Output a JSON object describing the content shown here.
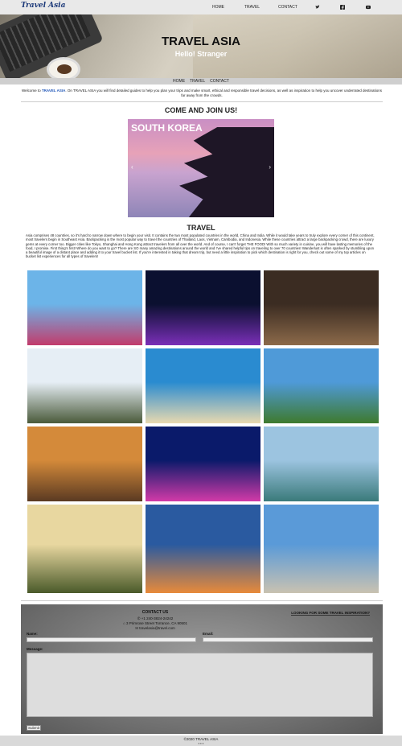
{
  "nav": {
    "logo": "Travel Asia",
    "links": [
      "HOME",
      "TRAVEL",
      "CONTACT"
    ],
    "social": [
      "twitter-icon",
      "facebook-icon",
      "youtube-icon"
    ]
  },
  "hero": {
    "title": "TRAVEL ASIA",
    "subtitle": "Hello! Stranger"
  },
  "subnav": {
    "links": [
      "HOME",
      "TRAVEL",
      "CONTACT"
    ]
  },
  "welcome": {
    "prefix": "Welcome to ",
    "brand": "TRAVEL ASIA",
    "text": ". On TRAVEL ASIA you will find detailed guides to help you plan your trips and make smart, ethical and responsible travel decisions, as well as inspiration to help you uncover underrated destinations far away from the crowds."
  },
  "join": {
    "heading": "COME AND JOIN US!",
    "slide_caption": "SOUTH KOREA",
    "prev": "‹",
    "next": "›"
  },
  "travel": {
    "heading": "TRAVEL",
    "paragraph": "Asia comprises 48 countries, so it's hard to narrow down where to begin your visit. It contains the two most populated countries in the world, China and India. While it would take years to truly explore every corner of this continent, most travelers begin in Southeast Asia. Backpacking is the most popular way to travel the countries of Thailand, Laos, Vietnam, Cambodia, and Indonesia. While these countries attract a large backpacking crowd, there are luxury gems at every corner too. Bigger cities like Tokyo, Shanghai and Hong Kong attract travelers from all over the world. And of course, I can't forget THE FOOD! With so much variety in cuisine, you will have lasting memories of the food, I promise. First thing's first! Where do you want to go? There are SO many amazing destinations around the world and I've shared helpful tips on traveling to over 70 countries! Wanderlust is often sparked by stumbling upon a beautiful image of a distant place and adding it to your travel bucket list. If you're interested in taking that dream trip, but need a little inspiration to pick which destination is right for you, check out some of my top articles on bucket list experiences for all types of travelers!"
  },
  "gallery": [
    {
      "name": "seoul-tower-photo",
      "colors": [
        "#6cb4e8",
        "#c23b6b"
      ]
    },
    {
      "name": "shanghai-night-photo",
      "colors": [
        "#0b1030",
        "#7a2fb8"
      ]
    },
    {
      "name": "kyoto-street-photo",
      "colors": [
        "#3b2c22",
        "#8c6a4a"
      ]
    },
    {
      "name": "temple-gate-photo",
      "colors": [
        "#e6eef5",
        "#4a5a3a"
      ]
    },
    {
      "name": "thai-beach-photo",
      "colors": [
        "#2a8bd0",
        "#e8d9b0"
      ]
    },
    {
      "name": "great-wall-photo",
      "colors": [
        "#4f9ad8",
        "#3e7a2e"
      ]
    },
    {
      "name": "angkor-wat-photo",
      "colors": [
        "#d48a3a",
        "#5a3a22"
      ]
    },
    {
      "name": "singapore-merlion-photo",
      "colors": [
        "#0a1a6a",
        "#d23aa8"
      ]
    },
    {
      "name": "halong-bay-photo",
      "colors": [
        "#9cc4e0",
        "#3a7a7a"
      ]
    },
    {
      "name": "bagan-sunset-photo",
      "colors": [
        "#e8d7a0",
        "#4a5a2a"
      ]
    },
    {
      "name": "mount-fuji-photo",
      "colors": [
        "#2a5aa0",
        "#e88a3a"
      ]
    },
    {
      "name": "gyeongbokgung-photo",
      "colors": [
        "#5a9ad8",
        "#c9c2b1"
      ]
    }
  ],
  "contact": {
    "title": "CONTACT US",
    "phone": "+1 240-3824-24242",
    "address": "3 Primrose Street Torrance, CA 90501",
    "email_addr": "travelasia@travel.com",
    "inspiration": "LOOKING FOR SOME TRAVEL INSPIRATION?",
    "name_label": "Name:",
    "email_label": "Email:",
    "message_label": "Message:",
    "submit": "Submit"
  },
  "footer": {
    "copyright": "©2020 TRAVEL ASIA"
  }
}
